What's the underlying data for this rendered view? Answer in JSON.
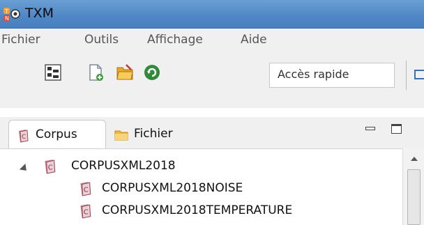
{
  "window": {
    "title": "TXM",
    "logo": "txm-logo-icon"
  },
  "menubar": {
    "items": [
      "Fichier",
      "Outils",
      "Affichage",
      "Aide"
    ]
  },
  "toolbar": {
    "icons": [
      "hierarchy-icon",
      "new-document-icon",
      "open-folder-icon",
      "refresh-icon"
    ],
    "quick_access": {
      "value": "Accès rapide"
    }
  },
  "view": {
    "tabs": [
      {
        "label": "Corpus",
        "icon": "corpus-icon",
        "selected": true
      },
      {
        "label": "Fichier",
        "icon": "folder-icon",
        "selected": false
      }
    ]
  },
  "tree": {
    "items": [
      {
        "label": "CORPUSXML2018",
        "level": 0,
        "expanded": true
      },
      {
        "label": "CORPUSXML2018NOISE",
        "level": 1
      },
      {
        "label": "CORPUSXML2018TEMPERATURE",
        "level": 1
      }
    ]
  },
  "colors": {
    "titlebar": "#4f86c6",
    "corpus_icon": "#b34a5a",
    "folder_icon": "#f2c14e"
  }
}
